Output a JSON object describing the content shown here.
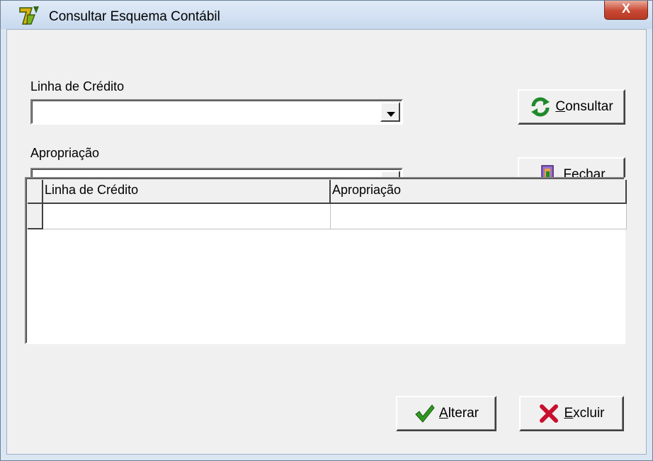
{
  "window": {
    "title": "Consultar Esquema Contábil",
    "close_label": "X"
  },
  "form": {
    "linha_label": "Linha de Crédito",
    "linha_value": "",
    "apropriacao_label": "Apropriação",
    "apropriacao_value": ""
  },
  "buttons": {
    "consultar": {
      "mnemonic": "C",
      "rest": "onsultar"
    },
    "fechar": {
      "mnemonic": "F",
      "rest": "echar"
    },
    "alterar": {
      "mnemonic": "A",
      "rest": "lterar"
    },
    "excluir": {
      "mnemonic": "E",
      "rest": "xcluir"
    }
  },
  "grid": {
    "columns": [
      "Linha de Crédito",
      "Apropriação"
    ],
    "rows": [
      [
        "",
        ""
      ]
    ]
  },
  "colors": {
    "titlebar": "#dfeaf7",
    "close_red": "#c74832",
    "face": "#f0f0f0"
  }
}
